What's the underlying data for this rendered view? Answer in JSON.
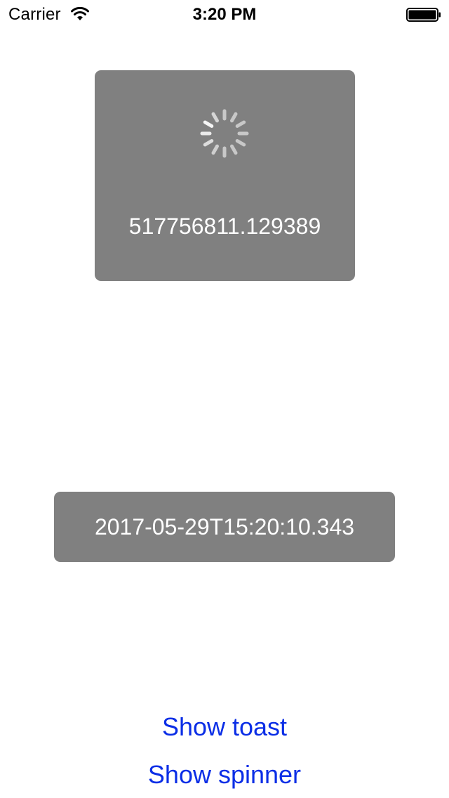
{
  "status_bar": {
    "carrier": "Carrier",
    "time": "3:20 PM",
    "wifi_icon": "wifi-icon",
    "battery_icon": "battery-icon"
  },
  "hud": {
    "icon": "activity-spinner-icon",
    "text": "517756811.129389",
    "background": "#808080"
  },
  "toast": {
    "text": "2017-05-29T15:20:10.343",
    "background": "#808080"
  },
  "buttons": {
    "show_toast": "Show toast",
    "show_spinner": "Show spinner",
    "color": "#0b2ee6"
  }
}
